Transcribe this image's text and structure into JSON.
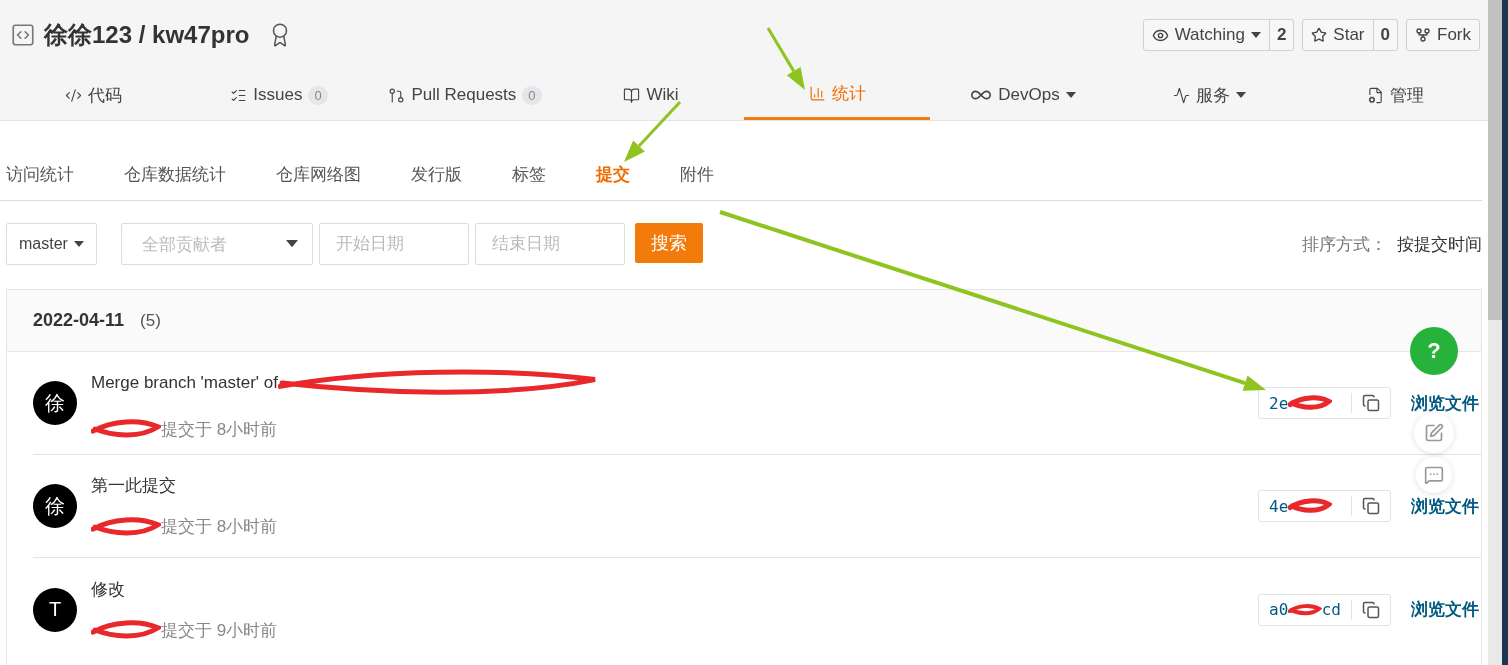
{
  "repo": {
    "owner": "徐徐123",
    "separator": "/",
    "name": "kw47pro"
  },
  "actions": [
    {
      "kind": "watch",
      "label": "Watching",
      "dropdown": true,
      "count": "2"
    },
    {
      "kind": "star",
      "label": "Star",
      "dropdown": false,
      "count": "0"
    },
    {
      "kind": "fork",
      "label": "Fork",
      "dropdown": false
    }
  ],
  "tabs": [
    {
      "kind": "code",
      "label": "代码",
      "selected": false,
      "dropdown": false
    },
    {
      "kind": "issues",
      "label": "Issues",
      "count": "0",
      "selected": false,
      "dropdown": false
    },
    {
      "kind": "pulls",
      "label": "Pull Requests",
      "count": "0",
      "selected": false,
      "dropdown": false
    },
    {
      "kind": "wiki",
      "label": "Wiki",
      "selected": false,
      "dropdown": false
    },
    {
      "kind": "stats",
      "label": "统计",
      "selected": true,
      "dropdown": false
    },
    {
      "kind": "devops",
      "label": "DevOps",
      "selected": false,
      "dropdown": true
    },
    {
      "kind": "services",
      "label": "服务",
      "selected": false,
      "dropdown": true
    },
    {
      "kind": "manage",
      "label": "管理",
      "selected": false,
      "dropdown": false
    }
  ],
  "subtabs": [
    {
      "label": "访问统计",
      "selected": false
    },
    {
      "label": "仓库数据统计",
      "selected": false
    },
    {
      "label": "仓库网络图",
      "selected": false
    },
    {
      "label": "发行版",
      "selected": false
    },
    {
      "label": "标签",
      "selected": false
    },
    {
      "label": "提交",
      "selected": true
    },
    {
      "label": "附件",
      "selected": false
    }
  ],
  "filters": {
    "branch": "master",
    "contributor_placeholder": "全部贡献者",
    "start_placeholder": "开始日期",
    "end_placeholder": "结束日期",
    "search_button": "搜索"
  },
  "sort": {
    "label": "排序方式：",
    "value": "按提交时间"
  },
  "date_group": {
    "date": "2022-04-11",
    "count": "(5)"
  },
  "commits": [
    {
      "avatar": "徐",
      "message": "Merge branch 'master' of",
      "message_redacted": true,
      "author_redacted": true,
      "meta": "提交于 8小时前",
      "hash_start": "2e",
      "browse": "浏览文件"
    },
    {
      "avatar": "徐",
      "message": "第一此提交",
      "author_redacted": true,
      "meta": "提交于 8小时前",
      "hash_start": "4e",
      "browse": "浏览文件"
    },
    {
      "avatar": "T",
      "message": "修改",
      "author_redacted": true,
      "meta": "提交于 9小时前",
      "hash_start": "a0",
      "hash_end": "cd",
      "browse": "浏览文件"
    }
  ],
  "help_button": "?",
  "annotations": [
    {
      "kind": "arrow"
    },
    {
      "kind": "arrow"
    },
    {
      "kind": "arrow"
    }
  ]
}
